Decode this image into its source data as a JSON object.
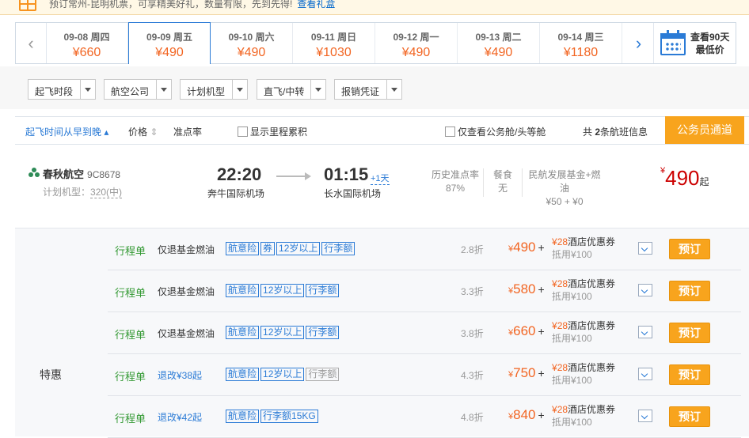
{
  "promo": {
    "text": "预订常州-昆明机票，可享精美好礼，数量有限，先到先得!",
    "link": "查看礼盒"
  },
  "dates": [
    {
      "date": "09-08 周四",
      "price": "¥660"
    },
    {
      "date": "09-09 周五",
      "price": "¥490"
    },
    {
      "date": "09-10 周六",
      "price": "¥490"
    },
    {
      "date": "09-11 周日",
      "price": "¥1030"
    },
    {
      "date": "09-12 周一",
      "price": "¥490"
    },
    {
      "date": "09-13 周二",
      "price": "¥490"
    },
    {
      "date": "09-14 周三",
      "price": "¥1180"
    }
  ],
  "active_date_index": 1,
  "see90": {
    "line1": "查看90天",
    "line2": "最低价"
  },
  "filters": [
    {
      "label": "起飞时段"
    },
    {
      "label": "航空公司"
    },
    {
      "label": "计划机型"
    },
    {
      "label": "直飞/中转"
    },
    {
      "label": "报销凭证"
    }
  ],
  "sortbar": {
    "sort_time": "起飞时间从早到晚",
    "sort_price": "价格",
    "sort_ontime": "准点率",
    "mileage": "显示里程累积",
    "business_only": "仅查看公务舱/头等舱",
    "count_prefix": "共",
    "count": "2",
    "count_suffix": "条航班信息",
    "civil_btn": "公务员通道"
  },
  "flight": {
    "airline": "春秋航空",
    "flight_no": "9C8678",
    "plane_label": "计划机型：",
    "plane": "320(中)",
    "dep_time": "22:20",
    "dep_airport": "奔牛国际机场",
    "arr_time": "01:15",
    "arr_plus": "+1天",
    "arr_airport": "长水国际机场",
    "ontime_label": "历史准点率",
    "ontime": "87%",
    "meal_label": "餐食",
    "meal": "无",
    "fund_label": "民航发展基金+燃油",
    "fund": "¥50 + ¥0",
    "price_cur": "¥",
    "price": "490",
    "price_suffix": "起"
  },
  "cabin_category": "特惠",
  "cabins": [
    {
      "receipt": "行程单",
      "rule": "仅退基金燃油",
      "rule_blue": false,
      "tags": [
        {
          "t": "航意险",
          "gray": false
        },
        {
          "t": "券",
          "gray": false
        },
        {
          "t": "12岁以上",
          "gray": false
        },
        {
          "t": "行李额",
          "gray": false
        }
      ],
      "discount": "2.8折",
      "price": "490",
      "coupon_amt": "28",
      "coupon": "酒店优惠券",
      "offset": "抵用¥100",
      "book": "预订"
    },
    {
      "receipt": "行程单",
      "rule": "仅退基金燃油",
      "rule_blue": false,
      "tags": [
        {
          "t": "航意险",
          "gray": false
        },
        {
          "t": "12岁以上",
          "gray": false
        },
        {
          "t": "行李额",
          "gray": false
        }
      ],
      "discount": "3.3折",
      "price": "580",
      "coupon_amt": "28",
      "coupon": "酒店优惠券",
      "offset": "抵用¥100",
      "book": "预订"
    },
    {
      "receipt": "行程单",
      "rule": "仅退基金燃油",
      "rule_blue": false,
      "tags": [
        {
          "t": "航意险",
          "gray": false
        },
        {
          "t": "12岁以上",
          "gray": false
        },
        {
          "t": "行李额",
          "gray": false
        }
      ],
      "discount": "3.8折",
      "price": "660",
      "coupon_amt": "28",
      "coupon": "酒店优惠券",
      "offset": "抵用¥100",
      "book": "预订"
    },
    {
      "receipt": "行程单",
      "rule": "退改¥38起",
      "rule_blue": true,
      "tags": [
        {
          "t": "航意险",
          "gray": false
        },
        {
          "t": "12岁以上",
          "gray": false
        },
        {
          "t": "行李额",
          "gray": true
        }
      ],
      "discount": "4.3折",
      "price": "750",
      "coupon_amt": "28",
      "coupon": "酒店优惠券",
      "offset": "抵用¥100",
      "book": "预订"
    },
    {
      "receipt": "行程单",
      "rule": "退改¥42起",
      "rule_blue": true,
      "tags": [
        {
          "t": "航意险",
          "gray": false
        },
        {
          "t": "行李额15KG",
          "gray": false
        }
      ],
      "discount": "4.8折",
      "price": "840",
      "coupon_amt": "28",
      "coupon": "酒店优惠券",
      "offset": "抵用¥100",
      "book": "预订"
    }
  ]
}
